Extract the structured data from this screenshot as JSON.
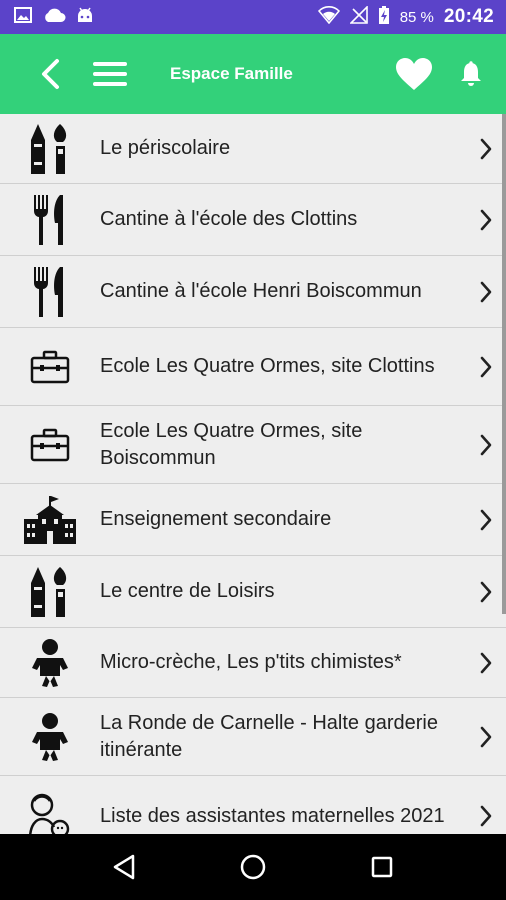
{
  "status_bar": {
    "battery_pct": "85 %",
    "time": "20:42"
  },
  "toolbar": {
    "title": "Espace Famille"
  },
  "items": [
    {
      "label": "Le périscolaire",
      "icon": "art-supplies-icon"
    },
    {
      "label": "Cantine à l'école des Clottins",
      "icon": "fork-knife-icon"
    },
    {
      "label": "Cantine à l'école Henri Boiscommun",
      "icon": "fork-knife-icon"
    },
    {
      "label": "Ecole Les Quatre Ormes, site Clottins",
      "icon": "briefcase-icon"
    },
    {
      "label": "Ecole Les Quatre Ormes, site Boiscommun",
      "icon": "briefcase-icon"
    },
    {
      "label": "Enseignement secondaire",
      "icon": "school-building-icon"
    },
    {
      "label": "Le centre de Loisirs",
      "icon": "art-supplies-icon"
    },
    {
      "label": "Micro-crèche, Les p'tits chimistes*",
      "icon": "baby-icon"
    },
    {
      "label": "La Ronde de Carnelle - Halte garderie itinérante",
      "icon": "baby-icon"
    },
    {
      "label": "Liste des assistantes maternelles 2021",
      "icon": "caregiver-icon"
    }
  ],
  "colors": {
    "status_bar": "#5b43c9",
    "toolbar": "#33d17a",
    "list_bg": "#eeeeee"
  }
}
